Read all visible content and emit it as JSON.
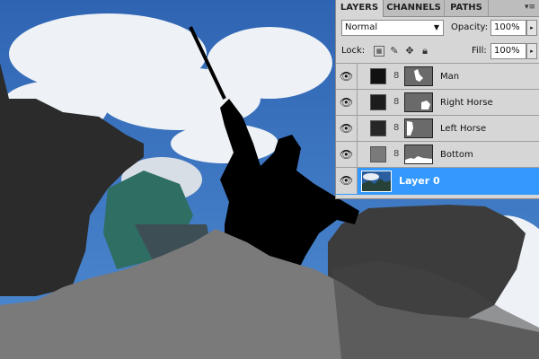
{
  "panel": {
    "tabs": [
      {
        "label": "LAYERS",
        "active": true
      },
      {
        "label": "CHANNELS",
        "active": false
      },
      {
        "label": "PATHS",
        "active": false
      }
    ],
    "menu_icon": "panel-menu-icon",
    "blend_mode": "Normal",
    "opacity_label": "Opacity:",
    "opacity_value": "100%",
    "lock_label": "Lock:",
    "fill_label": "Fill:",
    "fill_value": "100%",
    "lock_icons": [
      "transparency-lock-icon",
      "brush-lock-icon",
      "move-lock-icon",
      "padlock-icon"
    ]
  },
  "layers": [
    {
      "name": "Man",
      "visible": true,
      "selected": false,
      "thumb_color": "#111111"
    },
    {
      "name": "Right Horse",
      "visible": true,
      "selected": false,
      "thumb_color": "#1c1c1c"
    },
    {
      "name": "Left Horse",
      "visible": true,
      "selected": false,
      "thumb_color": "#262626"
    },
    {
      "name": "Bottom",
      "visible": true,
      "selected": false,
      "thumb_color": "#7a7a7a"
    },
    {
      "name": "Layer 0",
      "visible": true,
      "selected": true,
      "thumb_color": "#2a5e9e"
    }
  ],
  "colors": {
    "sky": "#3a6fb8",
    "man_fill": "#000000",
    "horse_fill": "#2b2b2b",
    "bottom_fill": "#7a7a7a",
    "selection": "#3399ff"
  }
}
